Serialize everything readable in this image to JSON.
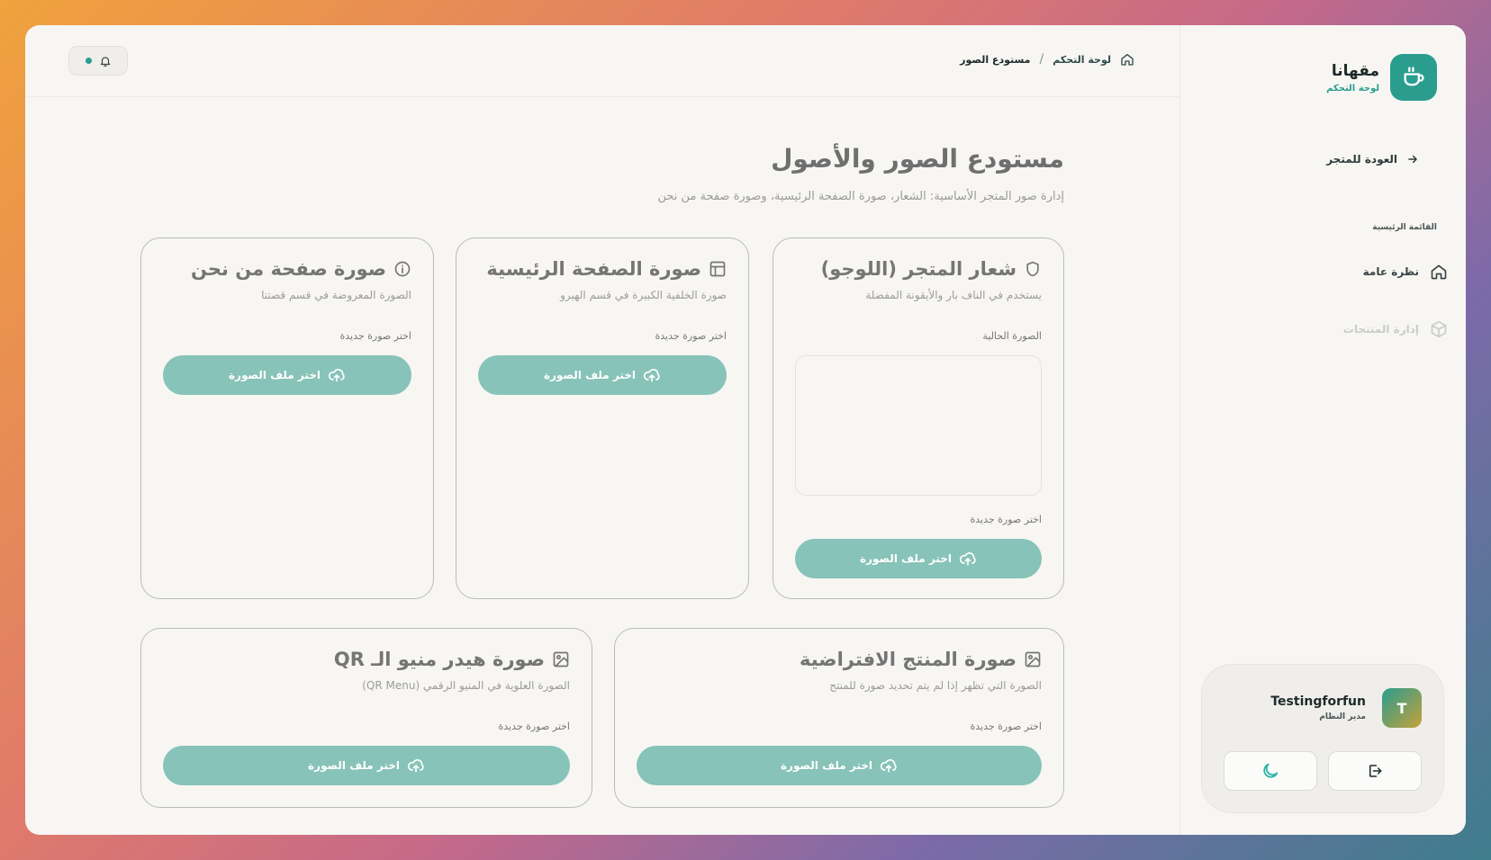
{
  "brand": {
    "name": "مقهانا",
    "subtitle": "لوحة التحكم"
  },
  "sidebar": {
    "back_label": "العودة للمتجر",
    "section_label": "القائمة الرئيسية",
    "items": [
      {
        "label": "نظرة عامة",
        "icon": "home-icon"
      },
      {
        "label": "إدارة المنتجات",
        "icon": "box-icon"
      }
    ]
  },
  "user": {
    "initial": "T",
    "name": "Testingforfun",
    "role": "مدير النظام"
  },
  "breadcrumb": {
    "home": "لوحة التحكم",
    "separator": "/",
    "current": "مستودع الصور"
  },
  "header": {
    "title": "مستودع الصور والأصول",
    "description": "إدارة صور المتجر الأساسية: الشعار، صورة الصفحة الرئيسية، وصورة صفحة من نحن"
  },
  "cards": [
    {
      "title": "شعار المتجر (اللوجو)",
      "description": "يستخدم في الناف بار والأيقونة المفضلة",
      "current_label": "الصورة الحالية",
      "choose_label": "اختر صورة جديدة",
      "button": "اختر ملف الصورة"
    },
    {
      "title": "صورة الصفحة الرئيسية",
      "description": "صورة الخلفية الكبيرة في قسم الهيرو",
      "choose_label": "اختر صورة جديدة",
      "button": "اختر ملف الصورة"
    },
    {
      "title": "صورة صفحة من نحن",
      "description": "الصورة المعروضة في قسم قصتنا",
      "choose_label": "اختر صورة جديدة",
      "button": "اختر ملف الصورة"
    },
    {
      "title": "صورة المنتج الافتراضية",
      "description": "الصورة التي تظهر إذا لم يتم تحديد صورة للمنتج",
      "choose_label": "اختر صورة جديدة",
      "button": "اختر ملف الصورة"
    },
    {
      "title": "صورة هيدر منيو الـ QR",
      "description": "الصورة العلوية في المنيو الرقمي (QR Menu)",
      "choose_label": "اختر صورة جديدة",
      "button": "اختر ملف الصورة"
    }
  ],
  "colors": {
    "accent": "#2a9d8f",
    "button": "#87c3b8"
  }
}
